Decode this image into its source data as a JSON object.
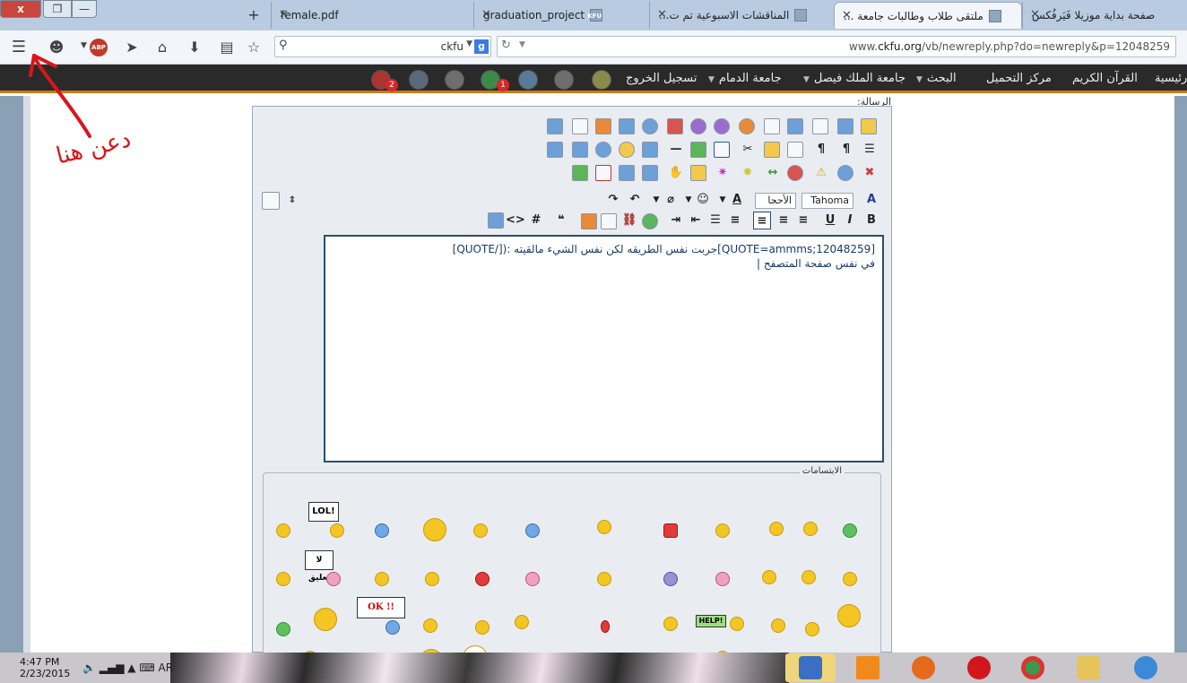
{
  "window": {
    "close": "x",
    "max": "❐",
    "min": "—"
  },
  "tabs": [
    {
      "title": "صفحة بداية موزيلا فَيَرفُكس",
      "active": false
    },
    {
      "title": "ملتقى طلاب وطالبات جامعة ...",
      "active": true
    },
    {
      "title": "المناقشات الاسبوعية تم ت...",
      "active": false
    },
    {
      "title": "graduation_project",
      "icon": "KFU",
      "active": false
    },
    {
      "title": "female.pdf",
      "active": false
    }
  ],
  "navbar": {
    "search_engine": "ckfu",
    "url_prefix": "www.",
    "url_host": "ckfu.org",
    "url_path": "/vb/newreply.php?do=newreply&p=12048259",
    "abp": "ABP"
  },
  "sitenav": {
    "items": [
      "رئيسية",
      "القرآن الكريم",
      "مركز التحميل",
      "البحث",
      "جامعة الملك فيصل",
      "جامعة الدمام",
      "تسجيل الخروج"
    ],
    "badges": [
      "1",
      "2"
    ]
  },
  "editor": {
    "label": "الرسالة:",
    "font_name": "Tahoma",
    "font_size": "الأحجا",
    "text_line1": "[QUOTE=ammms;12048259]جربت نفس الطريقه لكن نفس الشيء مالقيته :([/QUOTE]",
    "text_line2": "في نفس صفحة المتصفح |"
  },
  "smilies": {
    "title": "الابتسامات",
    "sign_lol": "LOL!",
    "sign_comment": "لا تعليق",
    "sign_ok": "OK !!",
    "sign_help": "HELP!"
  },
  "annotation": {
    "text": "دعن هنا"
  },
  "taskbar": {
    "time": "4:47 PM",
    "date": "2/23/2015",
    "lang": "AR"
  },
  "colors": {
    "accent": "#c97a1a",
    "sitebar": "#2a2a2a",
    "annotation": "#d8161c"
  }
}
